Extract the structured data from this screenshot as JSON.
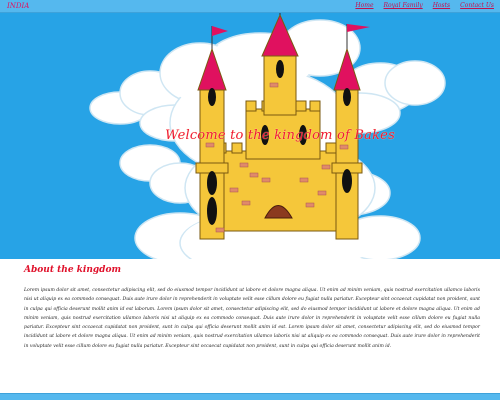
{
  "navbar": {
    "brand": "INDIA",
    "links": [
      "Home",
      "Royal Family",
      "Hosts",
      "Contact Us"
    ]
  },
  "hero": {
    "title": "Welcome to the kingdom of Bakes"
  },
  "about": {
    "heading": "About the kingdom",
    "body": "Lorem ipsum dolor sit amet, consectetur adipiscing elit, sed do eiusmod tempor incididunt ut labore et dolore magna aliqua. Ut enim ad minim veniam, quis nostrud exercitation ullamco laboris nisi ut aliquip ex ea commodo consequat. Duis aute irure dolor in reprehenderit in voluptate velit esse cillum dolore eu fugiat nulla pariatur. Excepteur sint occaecat cupidatat non proident, sunt in culpa qui officia deserunt mollit anim id est laborum. Lorem ipsum dolor sit amet, consectetur adipiscing elit, sed do eiusmod tempor incididunt ut labore et dolore magna aliqua. Ut enim ad minim veniam, quis nostrud exercitation ullamco laboris nisi ut aliquip ex ea commodo consequat. Duis aute irure dolor in reprehenderit in voluptate velit esse cillum dolore eu fugiat nulla pariatur. Excepteur sint occaecat cupidatat non proident, sunt in culpa qui officia deserunt mollit anim id est. Lorem ipsum dolor sit amet, consectetur adipiscing elit, sed do eiusmod tempor incididunt ut labore et dolore magna aliqua. Ut enim ad minim veniam, quis nostrud exercitation ullamco laboris nisi ut aliquip ex ea commodo consequat. Duis aute irure dolor in reprehenderit in voluptate velit esse cillum dolore eu fugiat nulla pariatur. Excepteur sint occaecat cupidatat non proident, sunt in culpa qui officia deserunt mollit anim id."
  },
  "colors": {
    "nav_bg": "#55b8ee",
    "sky": "#27a3e6",
    "cloud": "#ffffff",
    "castle": "#f5c73a",
    "roof": "#e0115f",
    "heading": "#e0102a"
  }
}
